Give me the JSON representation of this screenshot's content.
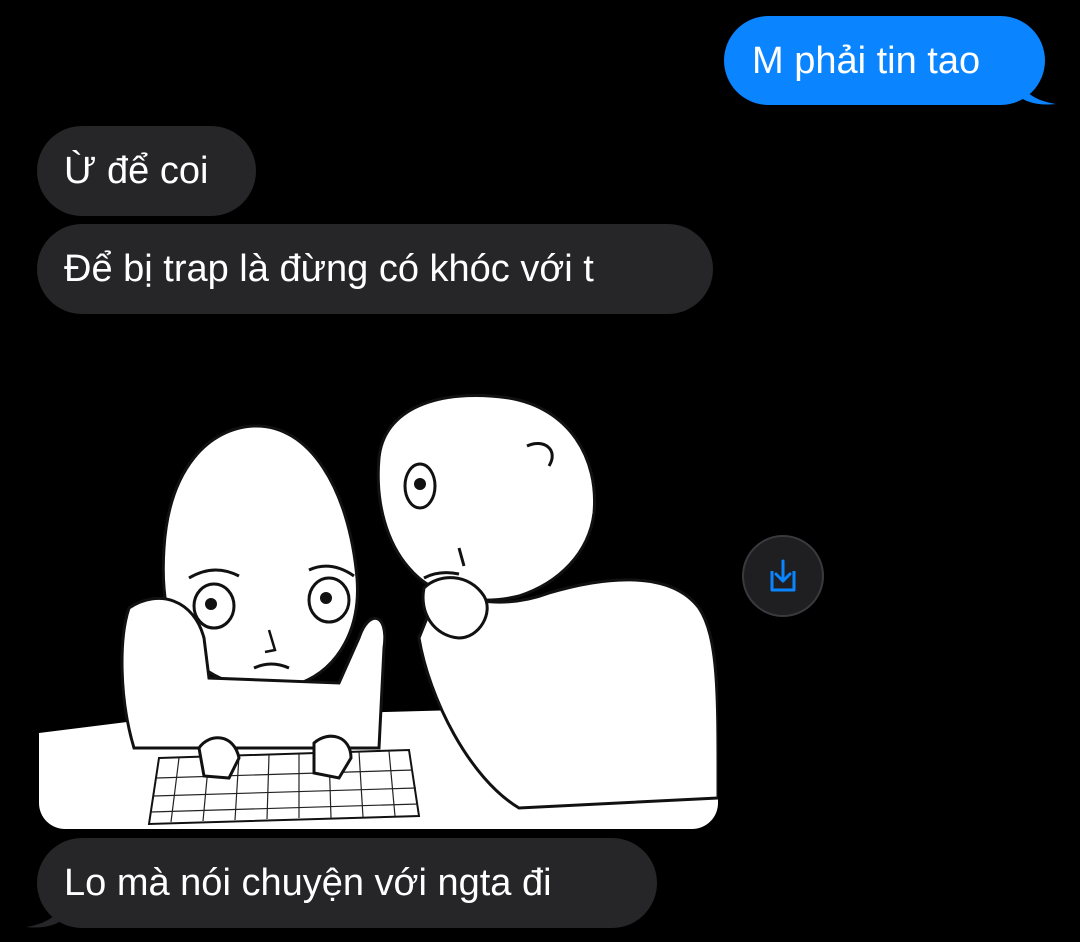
{
  "conversation": {
    "messages": [
      {
        "direction": "outgoing",
        "text": "M phải tin tao"
      },
      {
        "direction": "incoming",
        "text": "Ừ để coi"
      },
      {
        "direction": "incoming",
        "text": "Để bị trap là đừng có khóc với t"
      },
      {
        "direction": "incoming",
        "type": "image"
      },
      {
        "direction": "incoming",
        "text": "Lo mà nói chuyện với ngta đi"
      }
    ]
  },
  "image_actions": {
    "save_icon": "download-tray-icon"
  },
  "colors": {
    "background": "#000000",
    "outgoing_bubble": "#0a84ff",
    "incoming_bubble": "#262628",
    "text": "#ffffff",
    "accent_icon": "#0a84ff"
  }
}
